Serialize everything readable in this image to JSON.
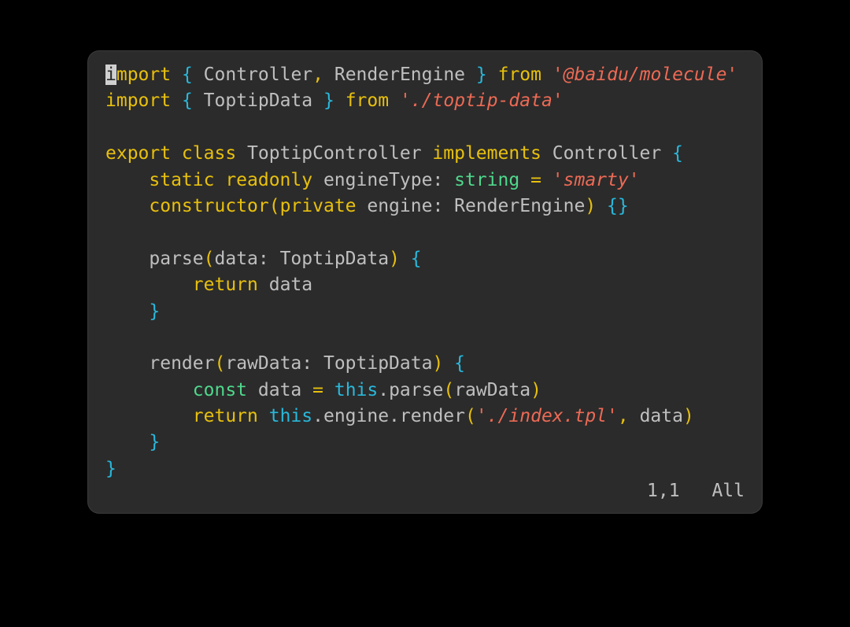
{
  "window": {
    "background_color": "#2b2b2b",
    "page_background_color": "#000000",
    "corner_radius_px": 14
  },
  "theme": {
    "keyword_color": "#e8c00d",
    "identifier_color": "#bfbfbf",
    "brace_color": "#29b8db",
    "paren_color": "#e8c00d",
    "type_color": "#4fd88c",
    "this_color": "#29b8db",
    "string_color": "#ec6a55",
    "cursor_background": "#d0d0d0",
    "cursor_foreground": "#2b2b2b"
  },
  "editor": {
    "language": "typescript",
    "cursor_char": "i",
    "lines": [
      {
        "index": 1,
        "text": "import { Controller, RenderEngine } from '@baidu/molecule'",
        "tokens": [
          {
            "text": "i",
            "kind": "kw",
            "cursor": true
          },
          {
            "text": "mport",
            "kind": "kw"
          },
          {
            "text": " ",
            "kind": "plain"
          },
          {
            "text": "{",
            "kind": "brace"
          },
          {
            "text": " Controller",
            "kind": "id"
          },
          {
            "text": ",",
            "kind": "op"
          },
          {
            "text": " RenderEngine ",
            "kind": "id"
          },
          {
            "text": "}",
            "kind": "brace"
          },
          {
            "text": " ",
            "kind": "plain"
          },
          {
            "text": "from",
            "kind": "kw"
          },
          {
            "text": " ",
            "kind": "plain"
          },
          {
            "text": "'@baidu/molecule'",
            "kind": "str"
          }
        ]
      },
      {
        "index": 2,
        "text": "import { ToptipData } from './toptip-data'",
        "tokens": [
          {
            "text": "import",
            "kind": "kw"
          },
          {
            "text": " ",
            "kind": "plain"
          },
          {
            "text": "{",
            "kind": "brace"
          },
          {
            "text": " ToptipData ",
            "kind": "id"
          },
          {
            "text": "}",
            "kind": "brace"
          },
          {
            "text": " ",
            "kind": "plain"
          },
          {
            "text": "from",
            "kind": "kw"
          },
          {
            "text": " ",
            "kind": "plain"
          },
          {
            "text": "'./toptip-data'",
            "kind": "str"
          }
        ]
      },
      {
        "index": 3,
        "text": "",
        "tokens": []
      },
      {
        "index": 4,
        "text": "export class ToptipController implements Controller {",
        "tokens": [
          {
            "text": "export class",
            "kind": "kw"
          },
          {
            "text": " ToptipController ",
            "kind": "id"
          },
          {
            "text": "implements",
            "kind": "kw"
          },
          {
            "text": " Controller ",
            "kind": "id"
          },
          {
            "text": "{",
            "kind": "brace"
          }
        ]
      },
      {
        "index": 5,
        "text": "    static readonly engineType: string = 'smarty'",
        "tokens": [
          {
            "text": "    ",
            "kind": "plain"
          },
          {
            "text": "static readonly",
            "kind": "kw"
          },
          {
            "text": " engineType: ",
            "kind": "id"
          },
          {
            "text": "string",
            "kind": "type"
          },
          {
            "text": " ",
            "kind": "plain"
          },
          {
            "text": "=",
            "kind": "op"
          },
          {
            "text": " ",
            "kind": "plain"
          },
          {
            "text": "'smarty'",
            "kind": "str"
          }
        ]
      },
      {
        "index": 6,
        "text": "    constructor(private engine: RenderEngine) {}",
        "tokens": [
          {
            "text": "    ",
            "kind": "plain"
          },
          {
            "text": "constructor",
            "kind": "kw"
          },
          {
            "text": "(",
            "kind": "paren"
          },
          {
            "text": "private",
            "kind": "kw"
          },
          {
            "text": " engine: RenderEngine",
            "kind": "id"
          },
          {
            "text": ")",
            "kind": "paren"
          },
          {
            "text": " ",
            "kind": "plain"
          },
          {
            "text": "{}",
            "kind": "brace"
          }
        ]
      },
      {
        "index": 7,
        "text": "",
        "tokens": []
      },
      {
        "index": 8,
        "text": "    parse(data: ToptipData) {",
        "tokens": [
          {
            "text": "    ",
            "kind": "plain"
          },
          {
            "text": "parse",
            "kind": "id"
          },
          {
            "text": "(",
            "kind": "paren"
          },
          {
            "text": "data: ToptipData",
            "kind": "id"
          },
          {
            "text": ")",
            "kind": "paren"
          },
          {
            "text": " ",
            "kind": "plain"
          },
          {
            "text": "{",
            "kind": "brace"
          }
        ]
      },
      {
        "index": 9,
        "text": "        return data",
        "tokens": [
          {
            "text": "        ",
            "kind": "plain"
          },
          {
            "text": "return",
            "kind": "kw"
          },
          {
            "text": " data",
            "kind": "id"
          }
        ]
      },
      {
        "index": 10,
        "text": "    }",
        "tokens": [
          {
            "text": "    ",
            "kind": "plain"
          },
          {
            "text": "}",
            "kind": "brace"
          }
        ]
      },
      {
        "index": 11,
        "text": "",
        "tokens": []
      },
      {
        "index": 12,
        "text": "    render(rawData: ToptipData) {",
        "tokens": [
          {
            "text": "    ",
            "kind": "plain"
          },
          {
            "text": "render",
            "kind": "id"
          },
          {
            "text": "(",
            "kind": "paren"
          },
          {
            "text": "rawData: ToptipData",
            "kind": "id"
          },
          {
            "text": ")",
            "kind": "paren"
          },
          {
            "text": " ",
            "kind": "plain"
          },
          {
            "text": "{",
            "kind": "brace"
          }
        ]
      },
      {
        "index": 13,
        "text": "        const data = this.parse(rawData)",
        "tokens": [
          {
            "text": "        ",
            "kind": "plain"
          },
          {
            "text": "const",
            "kind": "type"
          },
          {
            "text": " data ",
            "kind": "id"
          },
          {
            "text": "=",
            "kind": "op"
          },
          {
            "text": " ",
            "kind": "plain"
          },
          {
            "text": "this",
            "kind": "this"
          },
          {
            "text": ".parse",
            "kind": "id"
          },
          {
            "text": "(",
            "kind": "paren"
          },
          {
            "text": "rawData",
            "kind": "id"
          },
          {
            "text": ")",
            "kind": "paren"
          }
        ]
      },
      {
        "index": 14,
        "text": "        return this.engine.render('./index.tpl', data)",
        "tokens": [
          {
            "text": "        ",
            "kind": "plain"
          },
          {
            "text": "return",
            "kind": "kw"
          },
          {
            "text": " ",
            "kind": "plain"
          },
          {
            "text": "this",
            "kind": "this"
          },
          {
            "text": ".engine.render",
            "kind": "id"
          },
          {
            "text": "(",
            "kind": "paren"
          },
          {
            "text": "'./index.tpl'",
            "kind": "str"
          },
          {
            "text": ",",
            "kind": "op"
          },
          {
            "text": " data",
            "kind": "id"
          },
          {
            "text": ")",
            "kind": "paren"
          }
        ]
      },
      {
        "index": 15,
        "text": "    }",
        "tokens": [
          {
            "text": "    ",
            "kind": "plain"
          },
          {
            "text": "}",
            "kind": "brace"
          }
        ]
      },
      {
        "index": 16,
        "text": "}",
        "tokens": [
          {
            "text": "}",
            "kind": "brace"
          }
        ]
      }
    ]
  },
  "status_line": {
    "cursor_position": "1,1",
    "scroll_indicator": "All"
  }
}
